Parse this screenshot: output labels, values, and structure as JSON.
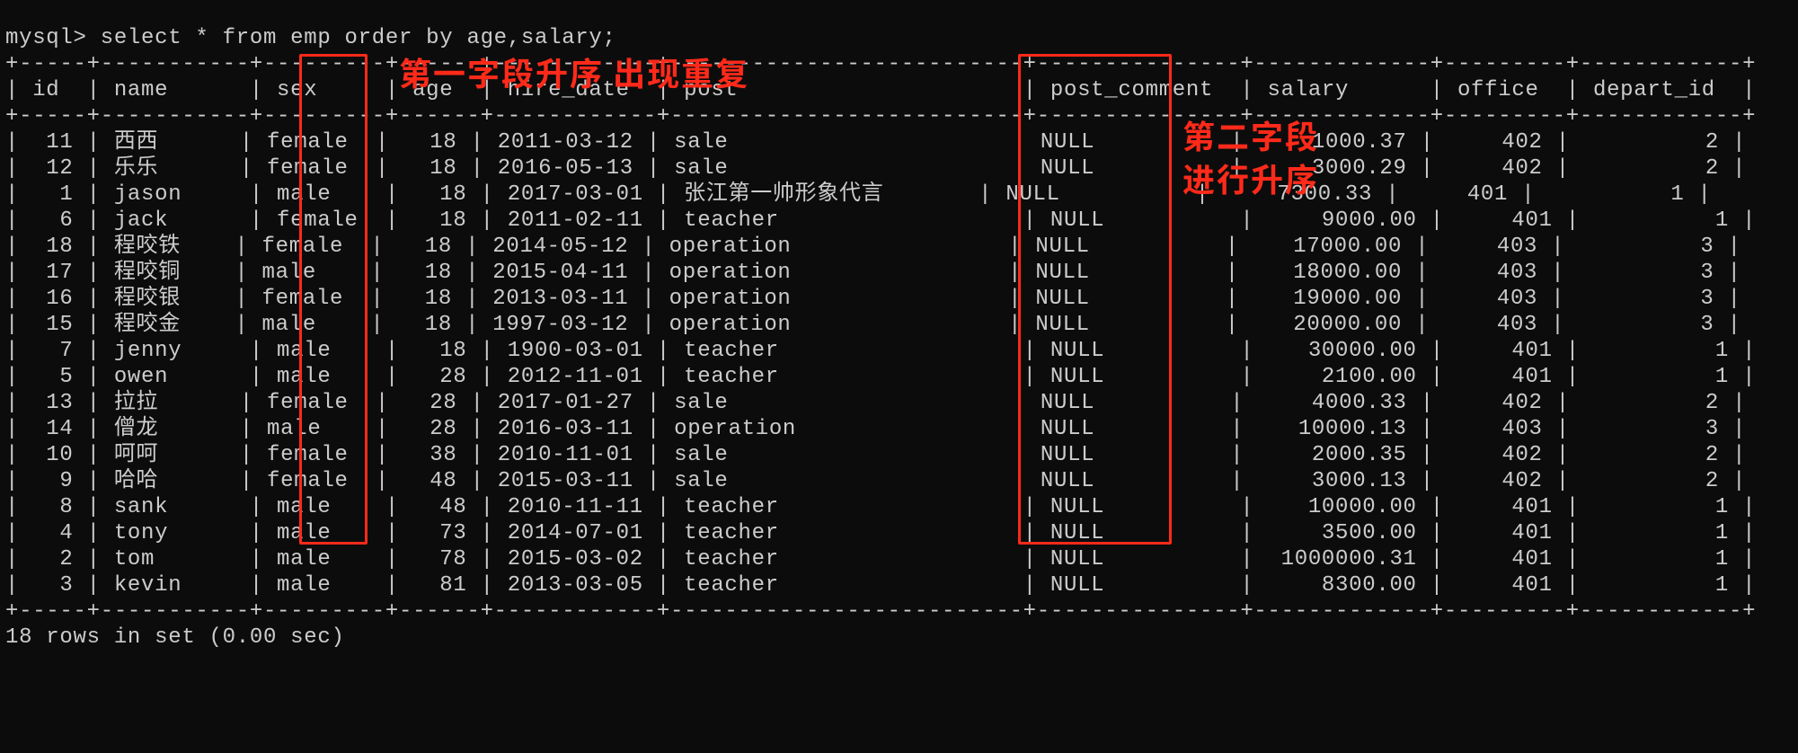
{
  "prompt_line": "mysql> select * from emp order by age,salary;",
  "headers": [
    "id",
    "name",
    "sex",
    "age",
    "hire_date",
    "post",
    "post_comment",
    "salary",
    "office",
    "depart_id"
  ],
  "rows": [
    {
      "id": "11",
      "name": "西西",
      "sex": "female",
      "age": "18",
      "hire_date": "2011-03-12",
      "post": "sale",
      "post_comment": "NULL",
      "salary": "1000.37",
      "office": "402",
      "depart_id": "2"
    },
    {
      "id": "12",
      "name": "乐乐",
      "sex": "female",
      "age": "18",
      "hire_date": "2016-05-13",
      "post": "sale",
      "post_comment": "NULL",
      "salary": "3000.29",
      "office": "402",
      "depart_id": "2"
    },
    {
      "id": "1",
      "name": "jason",
      "sex": "male",
      "age": "18",
      "hire_date": "2017-03-01",
      "post": "张江第一帅形象代言",
      "post_comment": "NULL",
      "salary": "7300.33",
      "office": "401",
      "depart_id": "1"
    },
    {
      "id": "6",
      "name": "jack",
      "sex": "female",
      "age": "18",
      "hire_date": "2011-02-11",
      "post": "teacher",
      "post_comment": "NULL",
      "salary": "9000.00",
      "office": "401",
      "depart_id": "1"
    },
    {
      "id": "18",
      "name": "程咬铁",
      "sex": "female",
      "age": "18",
      "hire_date": "2014-05-12",
      "post": "operation",
      "post_comment": "NULL",
      "salary": "17000.00",
      "office": "403",
      "depart_id": "3"
    },
    {
      "id": "17",
      "name": "程咬铜",
      "sex": "male",
      "age": "18",
      "hire_date": "2015-04-11",
      "post": "operation",
      "post_comment": "NULL",
      "salary": "18000.00",
      "office": "403",
      "depart_id": "3"
    },
    {
      "id": "16",
      "name": "程咬银",
      "sex": "female",
      "age": "18",
      "hire_date": "2013-03-11",
      "post": "operation",
      "post_comment": "NULL",
      "salary": "19000.00",
      "office": "403",
      "depart_id": "3"
    },
    {
      "id": "15",
      "name": "程咬金",
      "sex": "male",
      "age": "18",
      "hire_date": "1997-03-12",
      "post": "operation",
      "post_comment": "NULL",
      "salary": "20000.00",
      "office": "403",
      "depart_id": "3"
    },
    {
      "id": "7",
      "name": "jenny",
      "sex": "male",
      "age": "18",
      "hire_date": "1900-03-01",
      "post": "teacher",
      "post_comment": "NULL",
      "salary": "30000.00",
      "office": "401",
      "depart_id": "1"
    },
    {
      "id": "5",
      "name": "owen",
      "sex": "male",
      "age": "28",
      "hire_date": "2012-11-01",
      "post": "teacher",
      "post_comment": "NULL",
      "salary": "2100.00",
      "office": "401",
      "depart_id": "1"
    },
    {
      "id": "13",
      "name": "拉拉",
      "sex": "female",
      "age": "28",
      "hire_date": "2017-01-27",
      "post": "sale",
      "post_comment": "NULL",
      "salary": "4000.33",
      "office": "402",
      "depart_id": "2"
    },
    {
      "id": "14",
      "name": "僧龙",
      "sex": "male",
      "age": "28",
      "hire_date": "2016-03-11",
      "post": "operation",
      "post_comment": "NULL",
      "salary": "10000.13",
      "office": "403",
      "depart_id": "3"
    },
    {
      "id": "10",
      "name": "呵呵",
      "sex": "female",
      "age": "38",
      "hire_date": "2010-11-01",
      "post": "sale",
      "post_comment": "NULL",
      "salary": "2000.35",
      "office": "402",
      "depart_id": "2"
    },
    {
      "id": "9",
      "name": "哈哈",
      "sex": "female",
      "age": "48",
      "hire_date": "2015-03-11",
      "post": "sale",
      "post_comment": "NULL",
      "salary": "3000.13",
      "office": "402",
      "depart_id": "2"
    },
    {
      "id": "8",
      "name": "sank",
      "sex": "male",
      "age": "48",
      "hire_date": "2010-11-11",
      "post": "teacher",
      "post_comment": "NULL",
      "salary": "10000.00",
      "office": "401",
      "depart_id": "1"
    },
    {
      "id": "4",
      "name": "tony",
      "sex": "male",
      "age": "73",
      "hire_date": "2014-07-01",
      "post": "teacher",
      "post_comment": "NULL",
      "salary": "3500.00",
      "office": "401",
      "depart_id": "1"
    },
    {
      "id": "2",
      "name": "tom",
      "sex": "male",
      "age": "78",
      "hire_date": "2015-03-02",
      "post": "teacher",
      "post_comment": "NULL",
      "salary": "1000000.31",
      "office": "401",
      "depart_id": "1"
    },
    {
      "id": "3",
      "name": "kevin",
      "sex": "male",
      "age": "81",
      "hire_date": "2013-03-05",
      "post": "teacher",
      "post_comment": "NULL",
      "salary": "8300.00",
      "office": "401",
      "depart_id": "1"
    }
  ],
  "footer": "18 rows in set (0.00 sec)",
  "annotations": {
    "top": "第一字段升序 出现重复",
    "right1": "第二字段",
    "right2": "进行升序"
  }
}
